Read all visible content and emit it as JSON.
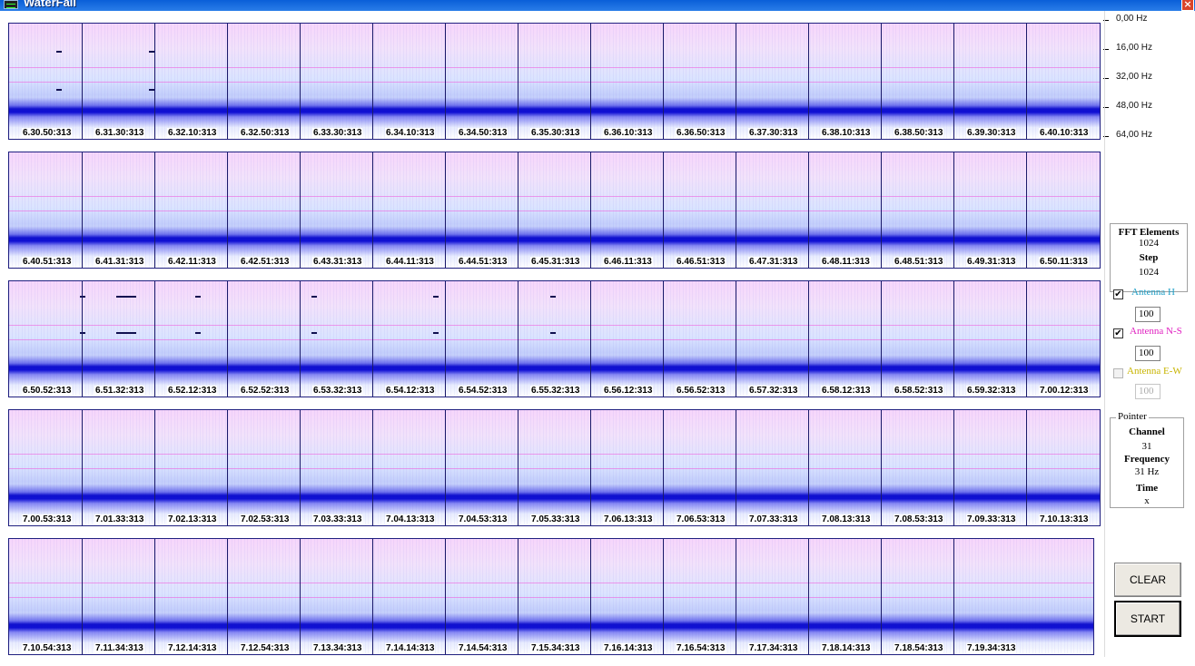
{
  "window": {
    "title": "WaterFall",
    "close_label": "×"
  },
  "colors": {
    "titlebar": "#0a5fd8",
    "waterfall_band": "#0a0ad2",
    "waterfall_background": "#f2e2fb",
    "antenna_h": "#20a0c8",
    "antenna_ns": "#e020c0",
    "antenna_ew": "#c8b400"
  },
  "frequency_axis": [
    "0,00 Hz",
    "16,00 Hz",
    "32,00 Hz",
    "48,00 Hz",
    "64,00 Hz"
  ],
  "rows": [
    {
      "timestamps": [
        "6.30.50:313",
        "6.31.30:313",
        "6.32.10:313",
        "6.32.50:313",
        "6.33.30:313",
        "6.34.10:313",
        "6.34.50:313",
        "6.35.30:313",
        "6.36.10:313",
        "6.36.50:313",
        "6.37.30:313",
        "6.38.10:313",
        "6.38.50:313",
        "6.39.30:313",
        "6.40.10:313"
      ]
    },
    {
      "timestamps": [
        "6.40.51:313",
        "6.41.31:313",
        "6.42.11:313",
        "6.42.51:313",
        "6.43.31:313",
        "6.44.11:313",
        "6.44.51:313",
        "6.45.31:313",
        "6.46.11:313",
        "6.46.51:313",
        "6.47.31:313",
        "6.48.11:313",
        "6.48.51:313",
        "6.49.31:313",
        "6.50.11:313"
      ]
    },
    {
      "timestamps": [
        "6.50.52:313",
        "6.51.32:313",
        "6.52.12:313",
        "6.52.52:313",
        "6.53.32:313",
        "6.54.12:313",
        "6.54.52:313",
        "6.55.32:313",
        "6.56.12:313",
        "6.56.52:313",
        "6.57.32:313",
        "6.58.12:313",
        "6.58.52:313",
        "6.59.32:313",
        "7.00.12:313"
      ]
    },
    {
      "timestamps": [
        "7.00.53:313",
        "7.01.33:313",
        "7.02.13:313",
        "7.02.53:313",
        "7.03.33:313",
        "7.04.13:313",
        "7.04.53:313",
        "7.05.33:313",
        "7.06.13:313",
        "7.06.53:313",
        "7.07.33:313",
        "7.08.13:313",
        "7.08.53:313",
        "7.09.33:313",
        "7.10.13:313"
      ]
    },
    {
      "timestamps": [
        "7.10.54:313",
        "7.11.34:313",
        "7.12.14:313",
        "7.12.54:313",
        "7.13.34:313",
        "7.14.14:313",
        "7.14.54:313",
        "7.15.34:313",
        "7.16.14:313",
        "7.16.54:313",
        "7.17.34:313",
        "7.18.14:313",
        "7.18.54:313",
        "7.19.34:313"
      ]
    }
  ],
  "fft": {
    "elements_label": "FFT Elements",
    "elements_value": "1024",
    "step_label": "Step",
    "step_value": "1024"
  },
  "antennas": [
    {
      "label": "Antenna H",
      "checked": true,
      "gain": "100",
      "enabled": true
    },
    {
      "label": "Antenna N-S",
      "checked": true,
      "gain": "100",
      "enabled": true
    },
    {
      "label": "Antenna E-W",
      "checked": false,
      "gain": "100",
      "enabled": false
    }
  ],
  "pointer": {
    "group_label": "Pointer",
    "channel_label": "Channel",
    "channel_value": "31",
    "frequency_label": "Frequency",
    "frequency_value": "31 Hz",
    "time_label": "Time",
    "time_value": "x"
  },
  "buttons": {
    "clear": "CLEAR",
    "start": "START"
  }
}
